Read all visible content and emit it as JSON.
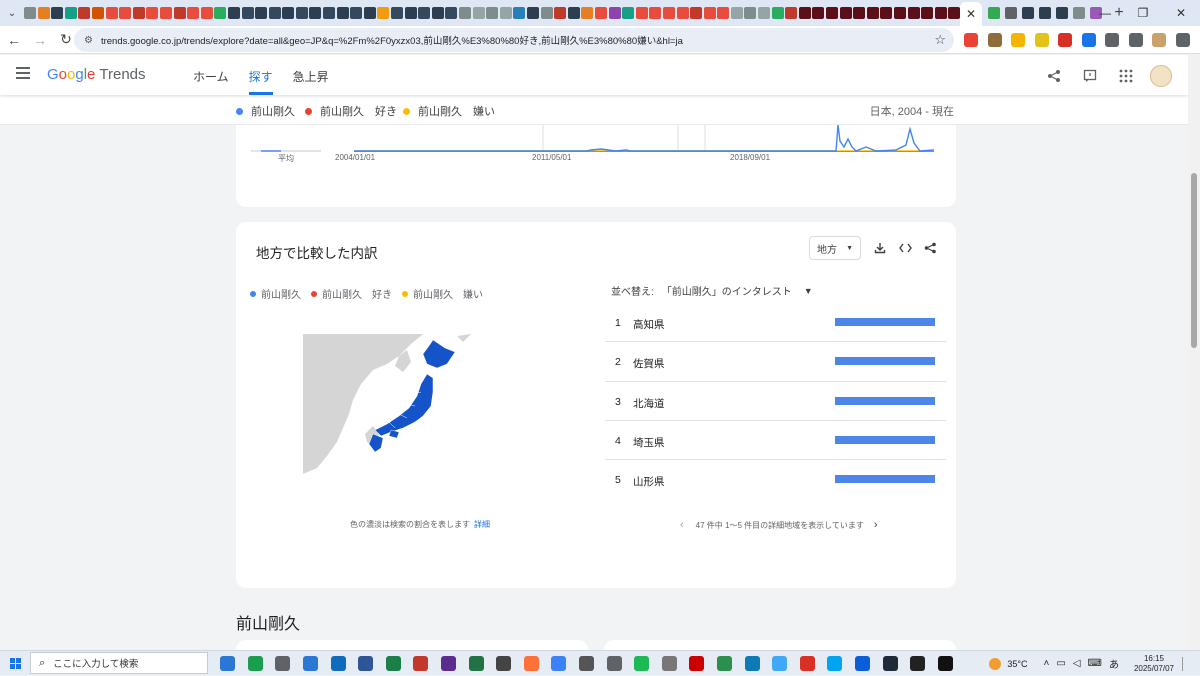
{
  "browser": {
    "tab_close_glyph": "✕",
    "new_tab_glyph": "+",
    "tab_favicon_colors": [
      "#7f8c8d",
      "#e67e22",
      "#2c3e50",
      "#16a085",
      "#c0392b",
      "#d35400",
      "#e74c3c",
      "#e74c3c",
      "#c0392b",
      "#e74c3c",
      "#e74c3c",
      "#c0392b",
      "#e74c3c",
      "#e74c3c",
      "#27ae60",
      "#2c3e50",
      "#34495e",
      "#2c3e50",
      "#34495e",
      "#2c3e50",
      "#34495e",
      "#2c3e50",
      "#34495e",
      "#2c3e50",
      "#34495e",
      "#2c3e50",
      "#f39c12",
      "#34495e",
      "#2c3e50",
      "#34495e",
      "#2c3e50",
      "#34495e",
      "#7f8c8d",
      "#95a5a6",
      "#7f8c8d",
      "#95a5a6",
      "#2980b9",
      "#2c3e50",
      "#7f8c8d",
      "#c0392b",
      "#2c3e50",
      "#e67e22",
      "#e74c3c",
      "#8e44ad",
      "#16a085",
      "#e74c3c",
      "#e74c3c",
      "#e74c3c",
      "#e74c3c",
      "#c0392b",
      "#e74c3c",
      "#e74c3c",
      "#95a5a6",
      "#7f8c8d",
      "#95a5a6",
      "#27ae60",
      "#c0392b",
      "#5a0f19",
      "#5a0f19",
      "#5a0f19",
      "#5a0f19",
      "#5a0f19",
      "#5a0f19",
      "#5a0f19",
      "#5a0f19",
      "#5a0f19",
      "#5a0f19",
      "#5a0f19",
      "#5a0f19",
      "#7f8c8d",
      "#2c3e50",
      "#5a0f19",
      "#5a0f19",
      "#5a0f19",
      "#7f8c8d",
      "#95a5a6",
      "#7f8c8d",
      "#f1c40f",
      "#f1c40f",
      "#f1c40f",
      "#f1c40f",
      "#f1c40f",
      "#f1c40f",
      "#f1c40f",
      "#f1c40f",
      "#f1c40f",
      "#f1c40f",
      "#f1c40f",
      "#f1c40f",
      "#f1c40f",
      "#f1c40f",
      "#7f8c8d",
      "#f1c40f"
    ],
    "tabs_after_colors": [
      "#34a853",
      "#5f6368",
      "#2c3e50",
      "#2c3e50",
      "#2c3e50",
      "#7f8c8d",
      "#9b59b6"
    ],
    "window_controls": [
      "—",
      "❐",
      "✕"
    ],
    "url": "trends.google.co.jp/trends/explore?date=all&geo=JP&q=%2Fm%2F0yxzx03,前山剛久%E3%80%80好き,前山剛久%E3%80%80嫌い&hl=ja",
    "extension_colors": [
      "#ea4335",
      "#8e6d3a",
      "#f4b400",
      "#e3c21a",
      "#d93025",
      "#1a73e8",
      "#5f6368",
      "#5f6368",
      "#c9a16b",
      "#5f6368"
    ]
  },
  "header": {
    "logo_google": [
      "G",
      "o",
      "o",
      "g",
      "l",
      "e"
    ],
    "logo_trends": "Trends",
    "nav": [
      "ホーム",
      "探す",
      "急上昇"
    ],
    "active_nav_index": 1
  },
  "legend_bar": {
    "terms": [
      {
        "label": "前山剛久",
        "color": "#4285f4"
      },
      {
        "label": "前山剛久　好き",
        "color": "#ea4335"
      },
      {
        "label": "前山剛久　嫌い",
        "color": "#fbbc04"
      }
    ],
    "region_date": "日本, 2004 - 現在"
  },
  "timeline": {
    "average_label": "平均",
    "dates": [
      "2004/01/01",
      "2011/05/01",
      "2018/09/01"
    ]
  },
  "region_card": {
    "title": "地方で比較した内訳",
    "resolution_select": "地方",
    "map_note": "色の濃淡は検索の割合を表します",
    "map_note_link": "詳細",
    "sort_label": "並べ替え:",
    "sort_value": "「前山剛久」のインタレスト",
    "sort_arrow": "▼",
    "rows": [
      {
        "rank": "1",
        "name": "高知県",
        "value": 100
      },
      {
        "rank": "2",
        "name": "佐賀県",
        "value": 100
      },
      {
        "rank": "3",
        "name": "北海道",
        "value": 100
      },
      {
        "rank": "4",
        "name": "埼玉県",
        "value": 100
      },
      {
        "rank": "5",
        "name": "山形県",
        "value": 100
      }
    ],
    "pager_text": "47 件中 1〜5 件目の詳細地域を表示しています",
    "pager_prev": "‹",
    "pager_next": "›"
  },
  "section": {
    "title": "前山剛久"
  },
  "taskbar": {
    "search_placeholder": "ここに入力して検索",
    "app_colors": [
      "#2b78d4",
      "#1b9e4b",
      "#5f6368",
      "#2b78d4",
      "#0f6cbd",
      "#2f5597",
      "#1c7f4a",
      "#c0392b",
      "#5b2d91",
      "#217346",
      "#444",
      "#ff7139",
      "#3b82f6",
      "#555",
      "#5f6368",
      "#1db954",
      "#777",
      "#c00",
      "#2d8f4e",
      "#0e79b2",
      "#3fa9f5",
      "#d93025",
      "#00a4ef",
      "#0b5ed7",
      "#1f2937",
      "#222",
      "#111"
    ],
    "temperature": "35°C",
    "ime": "あ",
    "time": "16:15",
    "date": "2025/07/07"
  }
}
